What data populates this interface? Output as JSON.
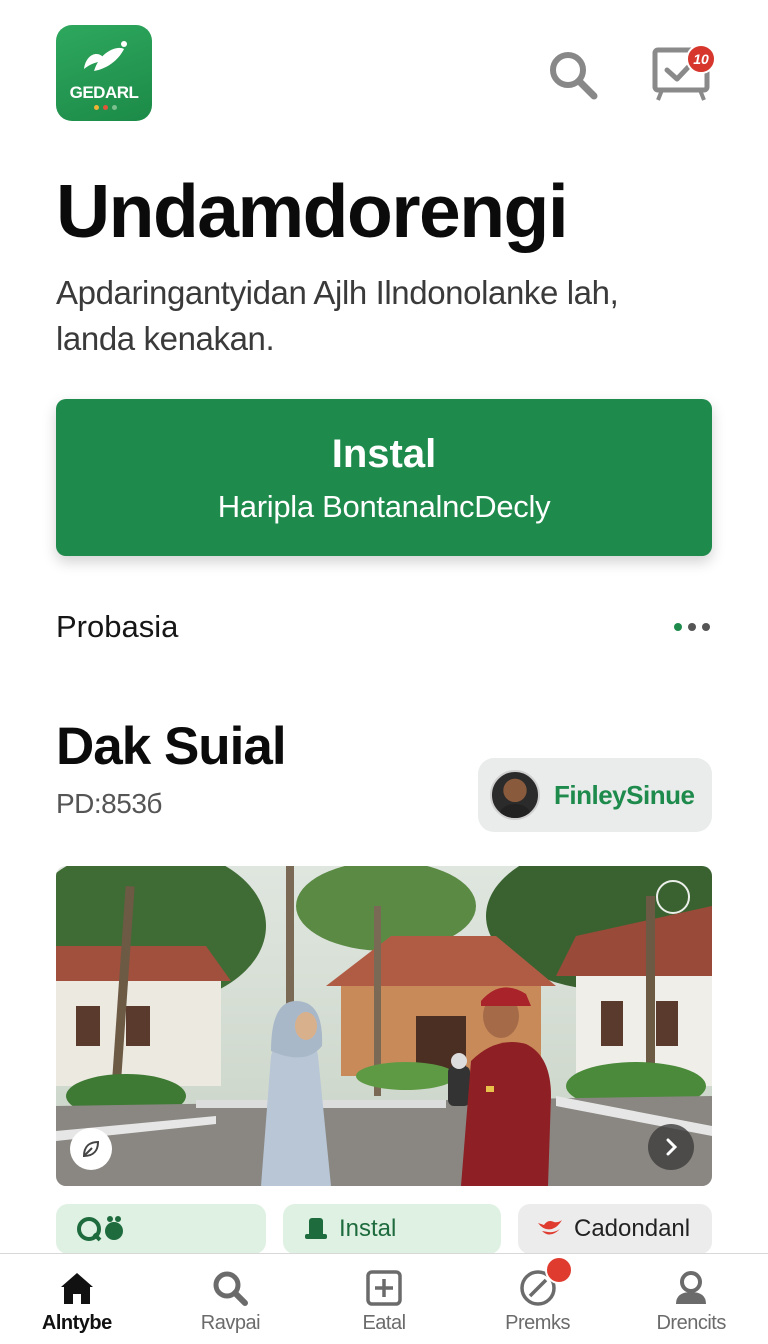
{
  "header": {
    "logo_text": "GEDARL",
    "notification_count": "10"
  },
  "hero": {
    "title": "Undamdorengi",
    "subtitle": "Apdaringantyidan Ajlh Ilndonolanke lah, landa kenakan."
  },
  "install_card": {
    "title": "Instal",
    "subtitle": "Haripla BontanalncDecly"
  },
  "section": {
    "label": "Probasia"
  },
  "detail": {
    "title": "Dak Suial",
    "code": "PD:853б"
  },
  "user_chip": {
    "name": "FinleySinue"
  },
  "actions": [
    {
      "label": "",
      "icon": "badge-icon"
    },
    {
      "label": "Instal",
      "icon": "phone-icon"
    },
    {
      "label": "Cadondanl",
      "icon": "bird-icon"
    }
  ],
  "bottom_nav": [
    {
      "label": "Alntybe",
      "icon": "home-icon",
      "active": true
    },
    {
      "label": "Ravpai",
      "icon": "search-icon"
    },
    {
      "label": "Eatal",
      "icon": "add-box-icon"
    },
    {
      "label": "Premks",
      "icon": "compass-icon"
    },
    {
      "label": "Drencits",
      "icon": "profile-icon"
    }
  ],
  "colors": {
    "brand_green": "#1e8a4c",
    "badge_red": "#d6362b"
  }
}
